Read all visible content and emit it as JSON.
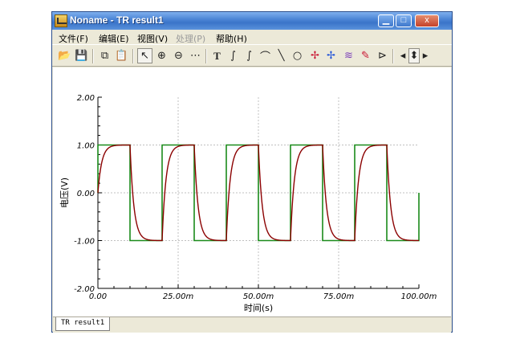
{
  "window": {
    "title": "Noname - TR result1"
  },
  "titlebar_buttons": {
    "minimize": "▁",
    "maximize": "□",
    "close": "x"
  },
  "menu": [
    {
      "label": "文件(F)",
      "enabled": true
    },
    {
      "label": "编辑(E)",
      "enabled": true
    },
    {
      "label": "视图(V)",
      "enabled": true
    },
    {
      "label": "处理(P)",
      "enabled": false
    },
    {
      "label": "帮助(H)",
      "enabled": true
    }
  ],
  "toolbar": {
    "tools": [
      {
        "name": "open-folder-icon",
        "glyph": "📂"
      },
      {
        "name": "save-icon",
        "glyph": "💾"
      },
      {
        "name": "copy-icon",
        "glyph": "⧉"
      },
      {
        "name": "paste-icon",
        "glyph": "📋"
      },
      {
        "name": "pointer-icon",
        "glyph": "↖",
        "pressed": true
      },
      {
        "name": "zoom-in-icon",
        "glyph": "⊕"
      },
      {
        "name": "zoom-out-icon",
        "glyph": "⊖"
      },
      {
        "name": "grid-icon",
        "glyph": "⋯"
      },
      {
        "name": "text-icon",
        "glyph": "T"
      },
      {
        "name": "label-curve-icon",
        "glyph": "∫"
      },
      {
        "name": "label-curve-2-icon",
        "glyph": "∫"
      },
      {
        "name": "label-curve-3-icon",
        "glyph": "⌒"
      },
      {
        "name": "line-icon",
        "glyph": "╲"
      },
      {
        "name": "circle-icon",
        "glyph": "○"
      },
      {
        "name": "cursor-a-icon",
        "glyph": "✢"
      },
      {
        "name": "cursor-b-icon",
        "glyph": "✢"
      },
      {
        "name": "waveform-add-icon",
        "glyph": "≋"
      },
      {
        "name": "pen-icon",
        "glyph": "✎"
      },
      {
        "name": "marker-icon",
        "glyph": "⊳"
      },
      {
        "name": "arrow-left-icon",
        "glyph": "◂"
      },
      {
        "name": "arrow-updown-icon",
        "glyph": "⬍"
      },
      {
        "name": "arrow-right-icon",
        "glyph": "▸"
      }
    ]
  },
  "tab": {
    "label": "TR result1"
  },
  "colors": {
    "input_trace": "#1a8a1a",
    "output_trace": "#8b0000",
    "grid": "#c0c0c0"
  },
  "chart_data": {
    "type": "line",
    "xlabel": "时间(s)",
    "ylabel": "电压(V)",
    "xlim": [
      0,
      0.1
    ],
    "ylim": [
      -2,
      2
    ],
    "x_ticks": [
      "0.00",
      "25.00m",
      "50.00m",
      "75.00m",
      "100.00m"
    ],
    "y_ticks": [
      "2.00",
      "1.00",
      "0.00",
      "-1.00",
      "-2.00"
    ],
    "grid": true,
    "series": [
      {
        "name": "",
        "kind": "square",
        "amplitude": 1.0,
        "period": 0.02,
        "high_start": 0.0,
        "high_end": 0.01,
        "color_key": "input_trace"
      },
      {
        "name": "",
        "kind": "rc",
        "amplitude": 1.0,
        "period": 0.02,
        "tau": 0.0012,
        "color_key": "output_trace"
      }
    ]
  }
}
